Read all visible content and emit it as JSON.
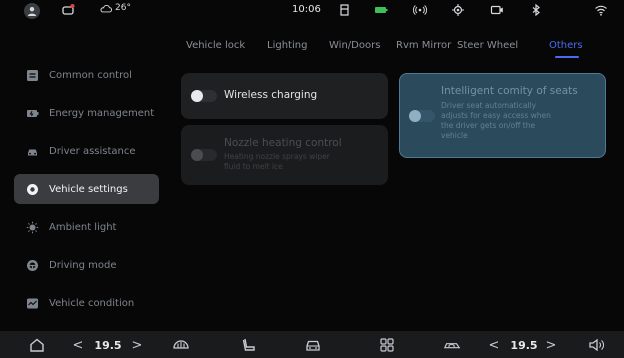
{
  "status_bar": {
    "temperature": "26°",
    "time": "10:06"
  },
  "tabs": [
    {
      "label": "Vehicle lock"
    },
    {
      "label": "Lighting"
    },
    {
      "label": "Win/Doors"
    },
    {
      "label": "Rvm Mirror"
    },
    {
      "label": "Steer Wheel"
    },
    {
      "label": "Others",
      "active": true
    }
  ],
  "sidebar": {
    "items": [
      {
        "label": "Common control",
        "icon": "common-control-icon"
      },
      {
        "label": "Energy management",
        "icon": "battery-icon"
      },
      {
        "label": "Driver assistance",
        "icon": "car-icon"
      },
      {
        "label": "Vehicle settings",
        "icon": "gear-icon",
        "active": true
      },
      {
        "label": "Ambient light",
        "icon": "bulb-icon"
      },
      {
        "label": "Driving mode",
        "icon": "steering-wheel-icon"
      },
      {
        "label": "Vehicle condition",
        "icon": "condition-icon"
      }
    ]
  },
  "cards": {
    "wireless_charging": {
      "title": "Wireless charging",
      "enabled": false
    },
    "nozzle_heating": {
      "title": "Nozzle heating control",
      "desc_line1": "Heating nozzle sprays wiper",
      "desc_line2": "fluid to melt ice",
      "enabled": false,
      "available": false
    },
    "intelligent_comity": {
      "title": "Intelligent comity of seats",
      "desc_line1": "Driver seat automatically",
      "desc_line2": "adjusts for easy access when",
      "desc_line3": "the driver gets on/off the",
      "desc_line4": "vehicle",
      "enabled": false
    }
  },
  "bottom_bar": {
    "left_temp": "19.5",
    "right_temp": "19.5",
    "chevron_left": "<",
    "chevron_right": ">"
  },
  "colors": {
    "accent": "#4a6cf0",
    "sidebar_active": "#3a3c40",
    "card": "#1f2022",
    "card_selected": "#2b4a5c"
  }
}
